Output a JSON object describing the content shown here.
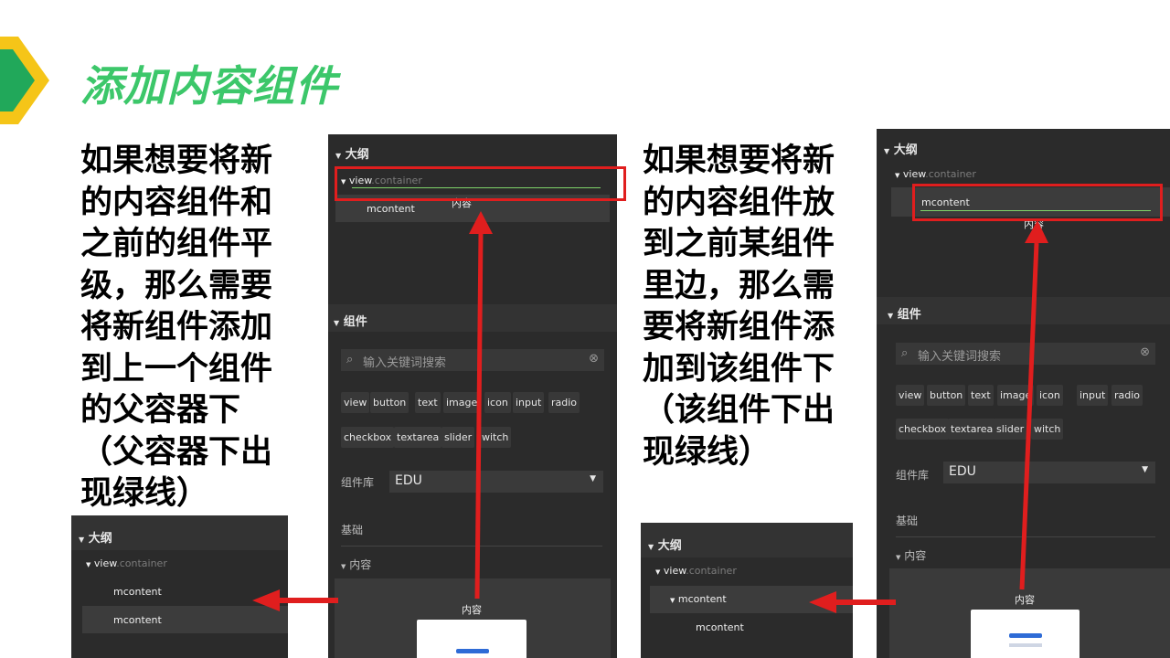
{
  "title": "添加内容组件",
  "left_text": "如果想要将新\n的内容组件和\n之前的组件平\n级，那么需要\n将新组件添加\n到上一个组件\n的父容器下\n（父容器下出\n现绿线）",
  "right_text": "如果想要将新\n的内容组件放\n到之前某组件\n里边，那么需\n要将新组件添\n加到该组件下\n（该组件下出\n现绿线）",
  "outline": {
    "header": "大纲",
    "view": "view",
    "container": ".container",
    "mcontent": "mcontent"
  },
  "components": {
    "header": "组件",
    "search_placeholder": "输入关键词搜索",
    "tags_row1": [
      "view",
      "button",
      "text",
      "image",
      "icon",
      "input",
      "radio"
    ],
    "tags_row2": [
      "checkbox",
      "textarea",
      "slider",
      "switch"
    ],
    "tags_row2_shown": [
      "checkbox",
      "textarea",
      "slider",
      "witch"
    ],
    "library_label": "组件库",
    "library_value": "EDU",
    "basic": "基础",
    "content": "内容",
    "content_card_label": "内容",
    "drag_label": "内容"
  },
  "colors": {
    "accent_green": "#3cc76a",
    "arrow_red": "#e01e1e",
    "panel_bg": "#2b2b2b",
    "chevron_green": "#21a85a",
    "chevron_yellow": "#f5c518"
  }
}
